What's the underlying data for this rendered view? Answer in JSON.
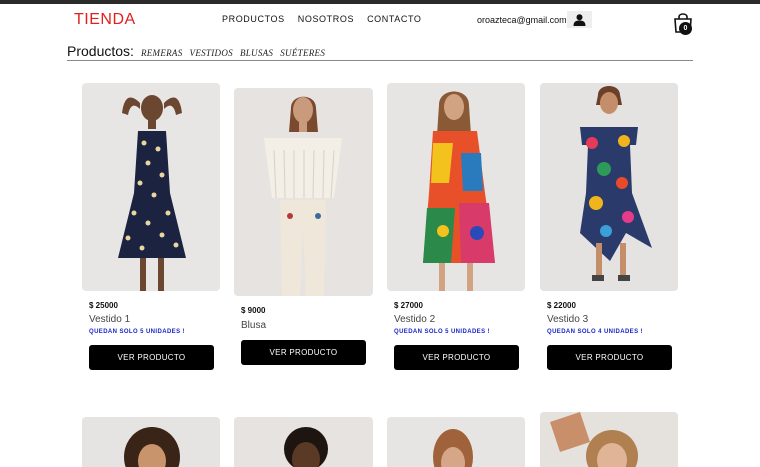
{
  "header": {
    "brand": "TIENDA",
    "nav": [
      "PRODUCTOS",
      "NOSOTROS",
      "CONTACTO"
    ],
    "email": "oroazteca@gmail.com",
    "cart_count": "0"
  },
  "categories": {
    "title": "Productos:",
    "filters": [
      "REMERAS",
      "VESTIDOS",
      "BLUSAS",
      "SUÉTERES"
    ]
  },
  "products": [
    {
      "price": "$ 25000",
      "name": "Vestido 1",
      "stock": "QUEDAN SOLO 5 UNIDADES !",
      "button": "VER PRODUCTO"
    },
    {
      "price": "$ 9000",
      "name": "Blusa",
      "stock": "",
      "button": "VER PRODUCTO"
    },
    {
      "price": "$ 27000",
      "name": "Vestido 2",
      "stock": "QUEDAN SOLO 5 UNIDADES !",
      "button": "VER PRODUCTO"
    },
    {
      "price": "$ 22000",
      "name": "Vestido 3",
      "stock": "QUEDAN SOLO 4 UNIDADES !",
      "button": "VER PRODUCTO"
    }
  ],
  "colors": {
    "brand": "#e0201e",
    "stock_text": "#1a24c8",
    "button_bg": "#000000"
  },
  "icons": [
    "user-icon",
    "shopping-bag-icon"
  ]
}
